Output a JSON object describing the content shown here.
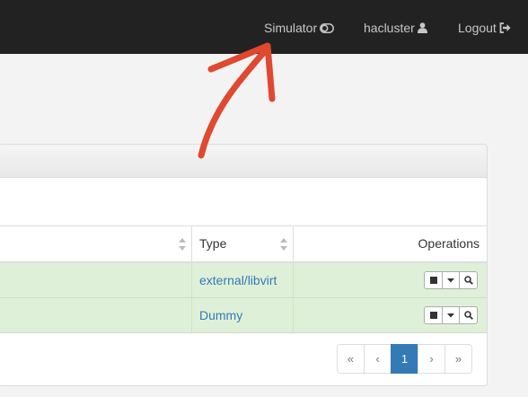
{
  "navbar": {
    "simulator_label": "Simulator",
    "user_label": "hacluster",
    "logout_label": "Logout"
  },
  "table": {
    "headers": {
      "type": "Type",
      "operations": "Operations"
    },
    "rows": [
      {
        "type": "external/libvirt",
        "status": "success"
      },
      {
        "type": "Dummy",
        "status": "success"
      }
    ],
    "row_actions": [
      "stop-icon",
      "caret-down-icon",
      "search-icon"
    ]
  },
  "pagination": {
    "first": "«",
    "prev": "‹",
    "current": "1",
    "next": "›",
    "last": "»"
  },
  "colors": {
    "navbar_bg": "#222222",
    "row_success_bg": "#dff0d8",
    "link": "#337ab7",
    "active_page": "#337ab7",
    "annotation_arrow": "#e0482f"
  }
}
